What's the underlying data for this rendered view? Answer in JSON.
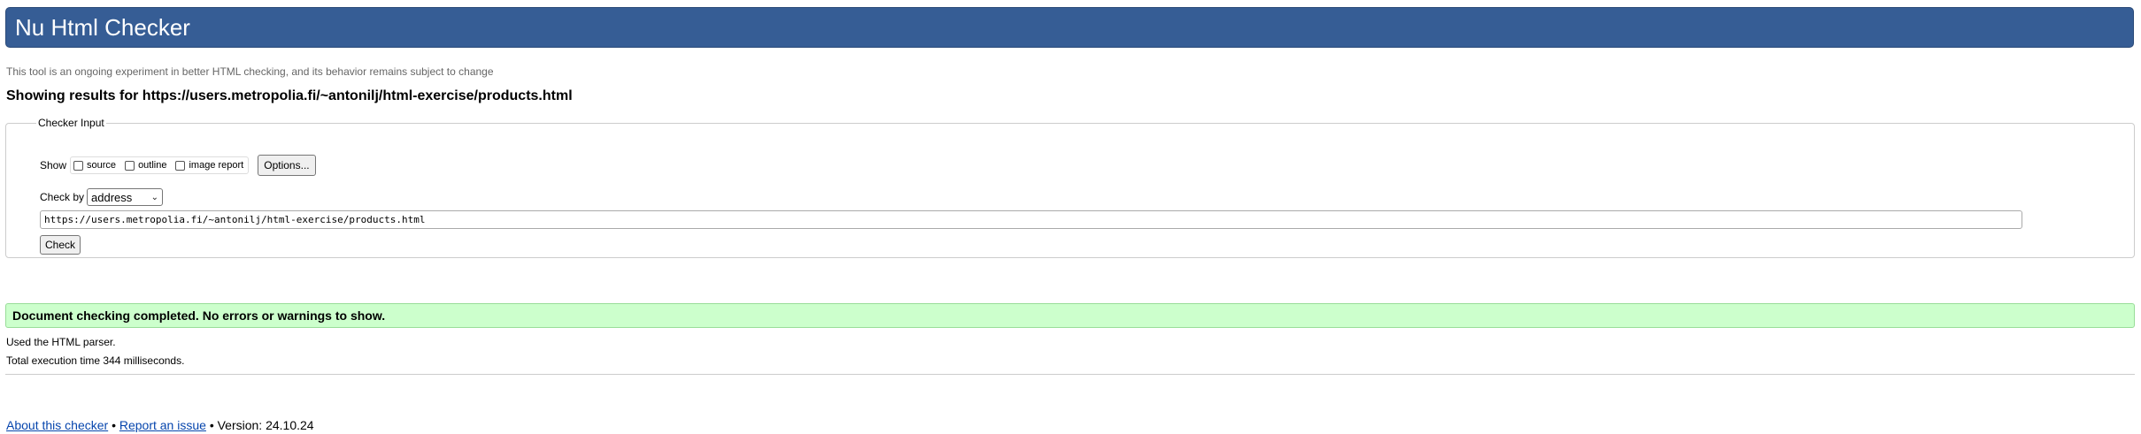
{
  "header": {
    "title": "Nu Html Checker"
  },
  "tagline": "This tool is an ongoing experiment in better HTML checking, and its behavior remains subject to change",
  "results_heading": "Showing results for https://users.metropolia.fi/~antonilj/html-exercise/products.html",
  "checker_input": {
    "legend": "Checker Input",
    "show_label": "Show",
    "options": [
      {
        "label": "source",
        "checked": false
      },
      {
        "label": "outline",
        "checked": false
      },
      {
        "label": "image report",
        "checked": false
      }
    ],
    "options_button": "Options...",
    "check_by_label": "Check by",
    "check_by_value": "address",
    "url_value": "https://users.metropolia.fi/~antonilj/html-exercise/products.html",
    "check_button": "Check"
  },
  "result": {
    "message": "Document checking completed. No errors or warnings to show.",
    "parser_info": "Used the HTML parser.",
    "execution_time": "Total execution time 344 milliseconds."
  },
  "footer": {
    "about_link": "About this checker",
    "separator": "•",
    "report_link": "Report an issue",
    "version": "Version: 24.10.24"
  },
  "colors": {
    "header_bg": "#365d95",
    "success_bg": "#ccffcc",
    "link": "#0645ad"
  }
}
